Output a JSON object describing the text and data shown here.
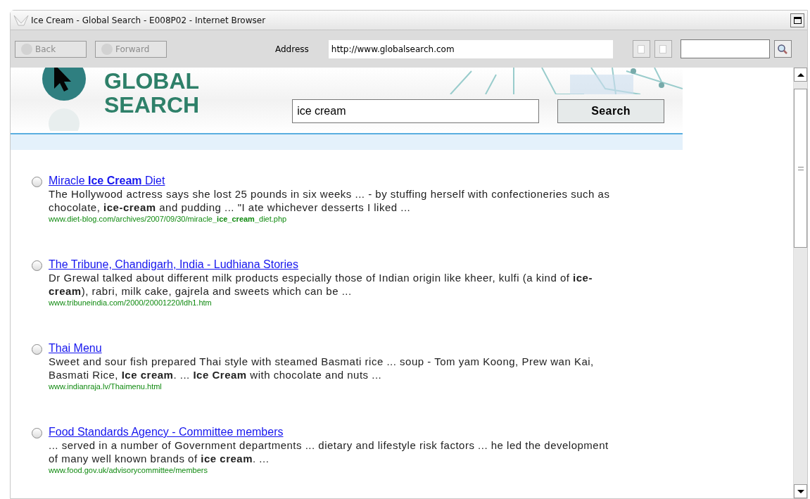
{
  "window": {
    "title": "Ice Cream - Global Search - E008P02 - Internet Browser"
  },
  "toolbar": {
    "back": {
      "label": "Back",
      "disabled": true
    },
    "forward": {
      "label": "Forward",
      "disabled": true
    },
    "address_label": "Address",
    "address": "http://www.globalsearch.com"
  },
  "site": {
    "logo_lines": [
      "GLOBAL",
      "SEARCH"
    ],
    "query": "ice cream",
    "search_button": "Search"
  },
  "results": [
    {
      "title": "Miracle **Ice Cream** Diet",
      "snippet": "The Hollywood actress says she lost 25 pounds in six weeks ... - by stuffing herself with confectioneries such as chocolate, **ice-cream** and pudding ... \"I ate whichever desserts I liked ...",
      "url": "www.diet-blog.com/archives/2007/09/30/miracle**_ice_cream_**diet.php",
      "selected": false
    },
    {
      "title": "The Tribune, Chandigarh, India - Ludhiana Stories",
      "snippet": "Dr Grewal talked about different milk products especially those of Indian origin like kheer, kulfi (a kind of **ice-cream**), rabri, milk cake, gajrela and sweets which can be ...",
      "url": "www.tribuneindia.com/2000/20001220/ldh1.htm",
      "selected": false
    },
    {
      "title": "Thai Menu",
      "snippet": "Sweet and sour fish prepared Thai style with steamed Basmati rice ... soup - Tom yam Koong, Prew wan Kai, Basmati Rice, **Ice cream**. ... **Ice Cream** with chocolate and nuts ...",
      "url": "www.indianraja.lv/Thaimenu.html",
      "selected": false
    },
    {
      "title": "Food Standards Agency - Committee members",
      "snippet": "... served in a number of Government departments ... dietary and lifestyle risk factors ... he led the development of many well known brands of **ice cream**. ...",
      "url": "www.food.gov.uk/advisorycommittee/members",
      "selected": false
    }
  ]
}
